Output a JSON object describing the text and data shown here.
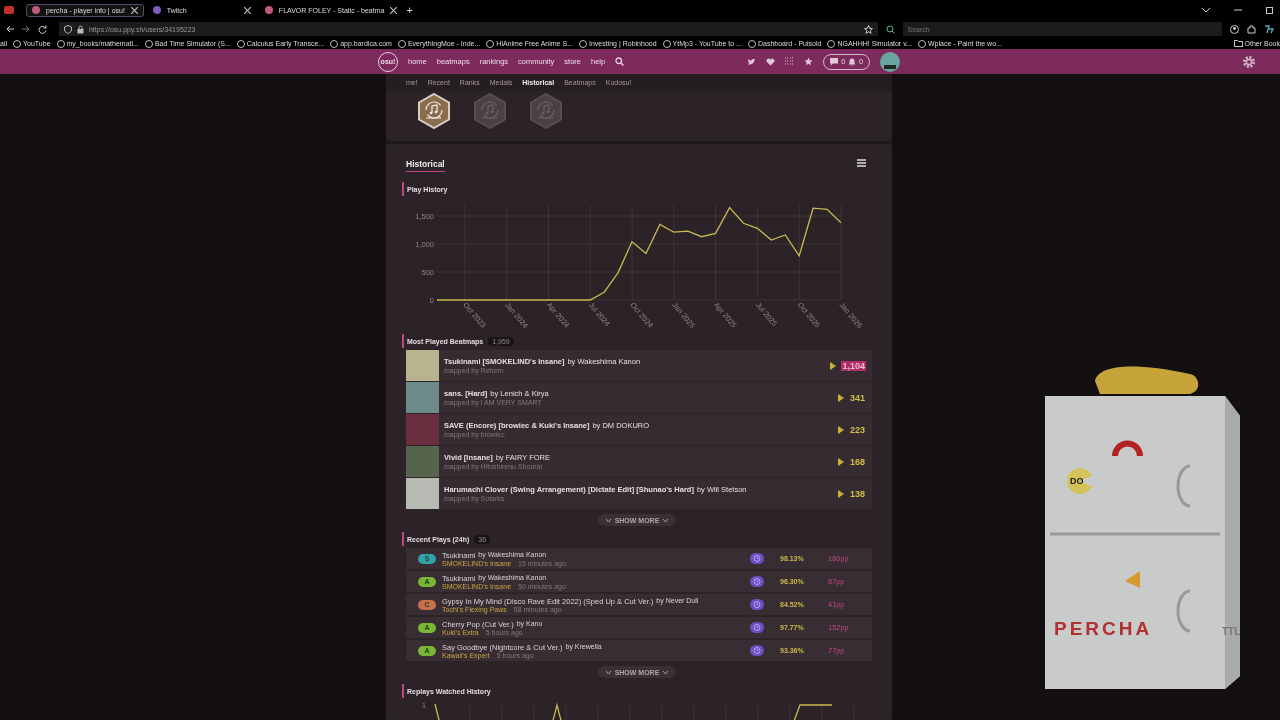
{
  "browser": {
    "tabs": [
      {
        "title": "percha - player info | osu!",
        "selected": true
      },
      {
        "title": "Twitch",
        "selected": false
      },
      {
        "title": "FLAVOR FOLEY - Static - beatma",
        "selected": false
      }
    ],
    "new_tab": "+",
    "url": "https://osu.ppy.sh/users/34195223",
    "search": {
      "placeholder": "Search"
    },
    "bookmarks": [
      "ail",
      "YouTube",
      "my_books/mathemati...",
      "Bad Time Simulator (S...",
      "Calculus Early Transce...",
      "app.bardica.com",
      "EverythingMoe - Inde...",
      "HiAnime Free Anime S...",
      "Investing | Robinhood",
      "YtMp3 - YouTube to ...",
      "Dashboard - Pulsoid",
      "NGAHHH! Simulator v...",
      "Wplace - Paint the wo..."
    ],
    "other_bookmarks": "Other Book"
  },
  "osu_nav": {
    "logo": "osu!",
    "links": [
      "home",
      "beatmaps",
      "rankings",
      "community",
      "store",
      "help"
    ],
    "chat_count": "0",
    "notification_count": "0"
  },
  "profile_tabs": [
    {
      "label": "me!",
      "selected": false
    },
    {
      "label": "Recent",
      "selected": false
    },
    {
      "label": "Ranks",
      "selected": false
    },
    {
      "label": "Medals",
      "selected": false
    },
    {
      "label": "Historical",
      "selected": true
    },
    {
      "label": "Beatmaps",
      "selected": false
    },
    {
      "label": "Kudosu!",
      "selected": false
    }
  ],
  "medals": [
    {
      "unlocked": true
    },
    {
      "unlocked": false
    },
    {
      "unlocked": false
    }
  ],
  "historical": {
    "title": "Historical",
    "play_history": {
      "title": "Play History",
      "chart_data": {
        "type": "line",
        "grid": true,
        "categories": [
          null,
          null,
          "Oct 2023",
          null,
          null,
          "Jan 2024",
          null,
          null,
          "Apr 2024",
          null,
          null,
          "Jul 2024",
          null,
          null,
          "Oct 2024",
          null,
          null,
          "Jan 2025",
          null,
          null,
          "Apr 2025",
          null,
          null,
          "Jul 2025",
          null,
          null,
          "Oct 2025",
          null,
          null,
          "Jan 2026"
        ],
        "series": [
          {
            "color": "#c9b94f",
            "values": [
              0,
              0,
              0,
              0,
              0,
              0,
              0,
              0,
              0,
              0,
              0,
              0,
              140,
              490,
              1040,
              830,
              1350,
              1210,
              1230,
              1130,
              1190,
              1650,
              1370,
              1280,
              1070,
              1160,
              790,
              1640,
              1620,
              1380
            ]
          }
        ],
        "yticks": [
          {
            "value": 0,
            "label": "0"
          },
          {
            "value": 500,
            "label": "500"
          },
          {
            "value": 1000,
            "label": "1,000"
          },
          {
            "value": 1500,
            "label": "1,500"
          }
        ],
        "ylim": [
          0,
          1700
        ]
      }
    },
    "most_played": {
      "title": "Most Played Beatmaps",
      "count": "1,959",
      "show_more": "SHOW MORE",
      "items": [
        {
          "title": "Tsukinami [SMOKELIND's Insane]",
          "artist": "by Wakeshima Kanon",
          "mapper": "mapped by Reform",
          "plays": "1,104",
          "highlighted": true
        },
        {
          "title": "sans. [Hard]",
          "artist": "by Lenich & Kirya",
          "mapper": "mapped by I AM VERY SMART",
          "plays": "341",
          "highlighted": false
        },
        {
          "title": "SAVE (Encore) [browiec & Kuki's Insane]",
          "artist": "by DM DOKURO",
          "mapper": "mapped by browiec",
          "plays": "223",
          "highlighted": false
        },
        {
          "title": "Vivid [Insane]",
          "artist": "by FAIRY FORE",
          "mapper": "mapped by Hitoshirenu Shourai",
          "plays": "168",
          "highlighted": false
        },
        {
          "title": "Harumachi Clover (Swing Arrangement) [Dictate Edit] [Shunao's Hard]",
          "artist": "by Will Stetson",
          "mapper": "mapped by Sotarks",
          "plays": "138",
          "highlighted": false
        }
      ]
    },
    "recent_plays": {
      "title": "Recent Plays (24h)",
      "count": "36",
      "show_more": "SHOW MORE",
      "items": [
        {
          "grade": "S",
          "color": "#2fa3a8",
          "title": "Tsukinami",
          "artist": "by Wakeshima Kanon",
          "difficulty": "SMOKELIND's Insane",
          "time": "15 minutes ago",
          "accuracy": "98.13%",
          "pp": "160",
          "pp_unit": "pp"
        },
        {
          "grade": "A",
          "color": "#7bb534",
          "title": "Tsukinami",
          "artist": "by Wakeshima Kanon",
          "difficulty": "SMOKELIND's Insane",
          "time": "50 minutes ago",
          "accuracy": "96.30%",
          "pp": "67",
          "pp_unit": "pp"
        },
        {
          "grade": "C",
          "color": "#c8704e",
          "title": "Gypsy In My Mind (Disco Rave Edit 2022) (Sped Up & Cut Ver.)",
          "artist": "by Never Dull",
          "difficulty": "Tochi's Flexing Paws",
          "time": "58 minutes ago",
          "accuracy": "84.52%",
          "pp": "41",
          "pp_unit": "pp"
        },
        {
          "grade": "A",
          "color": "#7bb534",
          "title": "Cherry Pop (Cut Ver.)",
          "artist": "by Kano",
          "difficulty": "Kuki's Extra",
          "time": "5 hours ago",
          "accuracy": "97.77%",
          "pp": "152",
          "pp_unit": "pp"
        },
        {
          "grade": "A",
          "color": "#7bb534",
          "title": "Say Goodbye (Nightcore & Cut Ver.)",
          "artist": "by Krewella",
          "difficulty": "Kawaii's Expert",
          "time": "5 hours ago",
          "accuracy": "93.36%",
          "pp": "77",
          "pp_unit": "pp"
        }
      ]
    },
    "replays_watched": {
      "title": "Replays Watched History",
      "y_tick": "1"
    }
  },
  "fridge_drawing": {
    "name_text": "PERCHA",
    "face_text": "DO",
    "scribble_text": "TTL"
  }
}
